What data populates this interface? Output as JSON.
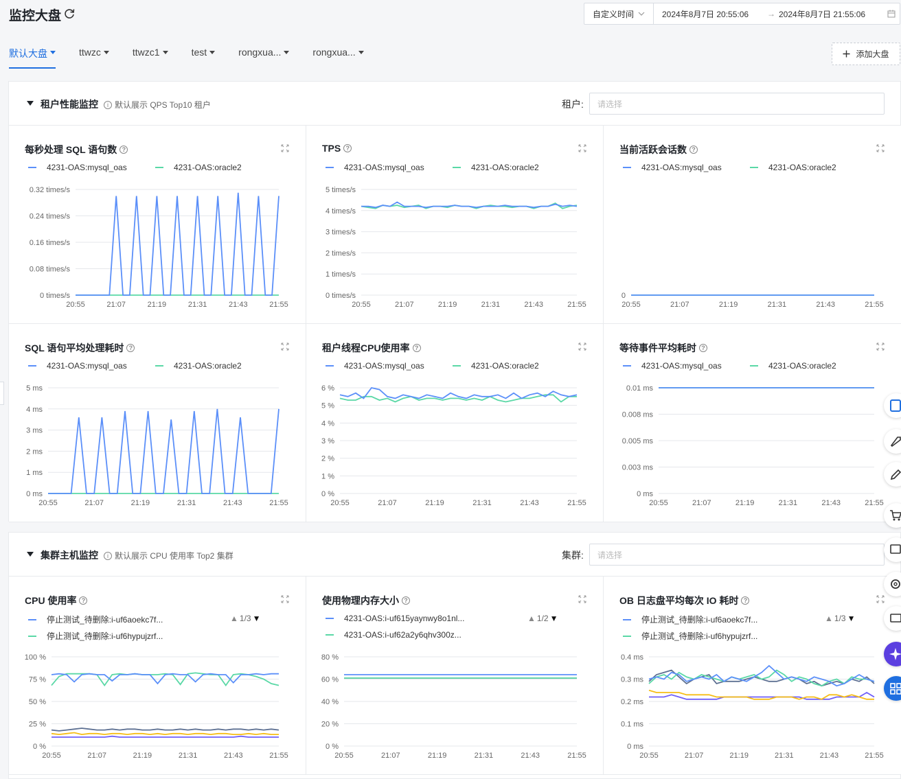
{
  "header": {
    "title": "监控大盘",
    "time_mode": "自定义时间",
    "time_start": "2024年8月7日 20:55:06",
    "time_arrow": "→",
    "time_end": "2024年8月7日 21:55:06"
  },
  "tabs": [
    {
      "label": "默认大盘",
      "active": true
    },
    {
      "label": "ttwzc",
      "active": false
    },
    {
      "label": "ttwzc1",
      "active": false
    },
    {
      "label": "test",
      "active": false
    },
    {
      "label": "rongxua...",
      "active": false
    },
    {
      "label": "rongxua...",
      "active": false
    }
  ],
  "add_board_label": "添加大盘",
  "colors": {
    "series1": "#5b8ff9",
    "series2": "#5ad8a6",
    "series3": "#5d7092",
    "series4": "#f6bd16",
    "series5": "#6f5ef9",
    "accent": "#1f6fe0"
  },
  "x_ticks": [
    "20:55",
    "21:07",
    "21:19",
    "21:31",
    "21:43",
    "21:55"
  ],
  "tenant_section": {
    "title": "租户性能监控",
    "hint": "默认展示 QPS Top10 租户",
    "filter_label": "租户:",
    "filter_placeholder": "请选择",
    "panels": [
      {
        "title": "每秒处理 SQL 语句数",
        "legend": [
          "4231-OAS:mysql_oas",
          "4231-OAS:oracle2"
        ],
        "y_ticks": [
          "0.32 times/s",
          "0.24 times/s",
          "0.16 times/s",
          "0.08 times/s",
          "0 times/s"
        ]
      },
      {
        "title": "TPS",
        "legend": [
          "4231-OAS:mysql_oas",
          "4231-OAS:oracle2"
        ],
        "y_ticks": [
          "5 times/s",
          "4 times/s",
          "3 times/s",
          "2 times/s",
          "1 times/s",
          "0 times/s"
        ]
      },
      {
        "title": "当前活跃会话数",
        "legend": [
          "4231-OAS:mysql_oas",
          "4231-OAS:oracle2"
        ],
        "y_ticks": [
          "0"
        ]
      },
      {
        "title": "SQL 语句平均处理耗时",
        "legend": [
          "4231-OAS:mysql_oas",
          "4231-OAS:oracle2"
        ],
        "y_ticks": [
          "5 ms",
          "4 ms",
          "3 ms",
          "2 ms",
          "1 ms",
          "0 ms"
        ]
      },
      {
        "title": "租户线程CPU使用率",
        "legend": [
          "4231-OAS:mysql_oas",
          "4231-OAS:oracle2"
        ],
        "y_ticks": [
          "6 %",
          "5 %",
          "4 %",
          "3 %",
          "2 %",
          "1 %",
          "0 %"
        ]
      },
      {
        "title": "等待事件平均耗时",
        "legend": [
          "4231-OAS:mysql_oas",
          "4231-OAS:oracle2"
        ],
        "y_ticks": [
          "0.01 ms",
          "0.008 ms",
          "0.005 ms",
          "0.003 ms",
          "0 ms"
        ]
      }
    ]
  },
  "cluster_section": {
    "title": "集群主机监控",
    "hint": "默认展示 CPU 使用率 Top2 集群",
    "filter_label": "集群:",
    "filter_placeholder": "请选择",
    "panels": [
      {
        "title": "CPU 使用率",
        "legend": [
          "停止测试_待删除:i-uf6aoekc7f...",
          "停止测试_待删除:i-uf6hypujzrf..."
        ],
        "pager": "1/3",
        "y_ticks": [
          "100 %",
          "75 %",
          "50 %",
          "25 %",
          "0 %"
        ]
      },
      {
        "title": "使用物理内存大小",
        "legend": [
          "4231-OAS:i-uf615yaynwy8o1nl...",
          "4231-OAS:i-uf62a2y6qhv300z..."
        ],
        "pager": "1/2",
        "y_ticks": [
          "80 %",
          "60 %",
          "40 %",
          "20 %",
          "0 %"
        ]
      },
      {
        "title": "OB 日志盘平均每次 IO 耗时",
        "legend": [
          "停止测试_待删除:i-uf6aoekc7f...",
          "停止测试_待删除:i-uf6hypujzrf..."
        ],
        "pager": "1/3",
        "y_ticks": [
          "0.4 ms",
          "0.3 ms",
          "0.2 ms",
          "0.1 ms",
          "0 ms"
        ]
      }
    ]
  },
  "chart_data": [
    {
      "type": "line",
      "title": "每秒处理 SQL 语句数",
      "ylim": [
        0,
        0.32
      ],
      "x_range": [
        "20:55",
        "21:55"
      ],
      "series": [
        {
          "name": "4231-OAS:mysql_oas",
          "values": [
            0,
            0,
            0,
            0,
            0,
            0,
            0.3,
            0,
            0,
            0.3,
            0,
            0,
            0.3,
            0,
            0,
            0.3,
            0,
            0,
            0.3,
            0,
            0,
            0.3,
            0,
            0,
            0.31,
            0,
            0,
            0.3,
            0,
            0,
            0.3
          ]
        },
        {
          "name": "4231-OAS:oracle2",
          "values": [
            0,
            0,
            0,
            0,
            0,
            0,
            0,
            0,
            0,
            0,
            0,
            0,
            0,
            0,
            0,
            0,
            0,
            0,
            0,
            0,
            0,
            0,
            0,
            0,
            0,
            0,
            0,
            0,
            0,
            0,
            0
          ]
        }
      ]
    },
    {
      "type": "line",
      "title": "TPS",
      "ylim": [
        0,
        5
      ],
      "x_range": [
        "20:55",
        "21:55"
      ],
      "series": [
        {
          "name": "4231-OAS:mysql_oas",
          "values": [
            4.2,
            4.2,
            4.15,
            4.25,
            4.2,
            4.4,
            4.2,
            4.2,
            4.2,
            4.15,
            4.2,
            4.2,
            4.2,
            4.25,
            4.2,
            4.2,
            4.15,
            4.2,
            4.2,
            4.2,
            4.25,
            4.2,
            4.2,
            4.2,
            4.15,
            4.2,
            4.2,
            4.3,
            4.2,
            4.25,
            4.2
          ]
        },
        {
          "name": "4231-OAS:oracle2",
          "values": [
            4.2,
            4.15,
            4.1,
            4.25,
            4.2,
            4.25,
            4.15,
            4.2,
            4.25,
            4.1,
            4.2,
            4.2,
            4.15,
            4.25,
            4.2,
            4.2,
            4.1,
            4.2,
            4.25,
            4.2,
            4.2,
            4.15,
            4.2,
            4.2,
            4.1,
            4.2,
            4.2,
            4.35,
            4.1,
            4.2,
            4.25
          ]
        }
      ]
    },
    {
      "type": "line",
      "title": "当前活跃会话数",
      "ylim": [
        0,
        1
      ],
      "x_range": [
        "20:55",
        "21:55"
      ],
      "series": [
        {
          "name": "4231-OAS:mysql_oas",
          "values": [
            0,
            0,
            0,
            0,
            0,
            0,
            0,
            0,
            0,
            0,
            0
          ]
        },
        {
          "name": "4231-OAS:oracle2",
          "values": [
            0,
            0,
            0,
            0,
            0,
            0,
            0,
            0,
            0,
            0,
            0
          ]
        }
      ]
    },
    {
      "type": "line",
      "title": "SQL 语句平均处理耗时",
      "ylim": [
        0,
        5
      ],
      "x_range": [
        "20:55",
        "21:55"
      ],
      "series": [
        {
          "name": "4231-OAS:mysql_oas",
          "values": [
            0,
            0,
            0,
            0,
            3.6,
            0,
            0,
            3.6,
            0,
            0,
            3.9,
            0,
            0,
            3.9,
            0,
            0,
            3.5,
            0,
            0,
            3.9,
            0,
            0,
            4.0,
            0,
            0,
            3.6,
            0,
            0,
            0,
            0,
            4.0
          ]
        },
        {
          "name": "4231-OAS:oracle2",
          "values": [
            0,
            0,
            0,
            0,
            0,
            0,
            0,
            0,
            0,
            0,
            0,
            0,
            0,
            0,
            0,
            0,
            0,
            0,
            0,
            0,
            0,
            0,
            0,
            0,
            0,
            0,
            0,
            0,
            0,
            0,
            0
          ]
        }
      ]
    },
    {
      "type": "line",
      "title": "租户线程CPU使用率",
      "ylim": [
        0,
        6
      ],
      "x_range": [
        "20:55",
        "21:55"
      ],
      "series": [
        {
          "name": "4231-OAS:mysql_oas",
          "values": [
            5.6,
            5.5,
            5.7,
            5.4,
            6.0,
            5.9,
            5.5,
            5.4,
            5.6,
            5.5,
            5.4,
            5.6,
            5.5,
            5.4,
            5.7,
            5.5,
            5.4,
            5.6,
            5.5,
            5.5,
            5.6,
            5.4,
            5.7,
            5.4,
            5.6,
            5.7,
            5.5,
            5.8,
            5.6,
            5.5,
            5.6
          ]
        },
        {
          "name": "4231-OAS:oracle2",
          "values": [
            5.4,
            5.3,
            5.3,
            5.5,
            5.5,
            5.3,
            5.4,
            5.2,
            5.4,
            5.5,
            5.3,
            5.4,
            5.4,
            5.3,
            5.4,
            5.4,
            5.3,
            5.4,
            5.3,
            5.5,
            5.3,
            5.2,
            5.3,
            5.4,
            5.4,
            5.5,
            5.6,
            5.6,
            5.2,
            5.5,
            5.5
          ]
        }
      ]
    },
    {
      "type": "line",
      "title": "等待事件平均耗时",
      "ylim": [
        0,
        0.01
      ],
      "x_range": [
        "20:55",
        "21:55"
      ],
      "series": [
        {
          "name": "4231-OAS:mysql_oas",
          "values": [
            0.01,
            0.01,
            0.01,
            0.01,
            0.01,
            0.01,
            0.01,
            0.01,
            0.01,
            0.01,
            0.01
          ]
        },
        {
          "name": "4231-OAS:oracle2",
          "values": [
            0.01,
            0.01,
            0.01,
            0.01,
            0.01,
            0.01,
            0.01,
            0.01,
            0.01,
            0.01,
            0.01
          ]
        }
      ]
    },
    {
      "type": "line",
      "title": "CPU 使用率",
      "ylim": [
        0,
        100
      ],
      "x_range": [
        "20:55",
        "21:55"
      ],
      "series": [
        {
          "name": "停止测试_待删除:i-uf6aoekc7f...",
          "values": [
            80,
            81,
            80,
            72,
            80,
            81,
            80,
            80,
            73,
            80,
            80,
            81,
            80,
            80,
            70,
            80,
            81,
            80,
            80,
            72,
            80,
            81,
            80,
            80,
            71,
            80,
            80,
            81,
            80,
            81,
            81
          ]
        },
        {
          "name": "停止测试_待删除:i-uf6hypujzrf...",
          "values": [
            68,
            78,
            81,
            81,
            81,
            81,
            80,
            68,
            80,
            81,
            80,
            81,
            80,
            80,
            80,
            81,
            80,
            69,
            81,
            82,
            81,
            80,
            80,
            68,
            80,
            81,
            80,
            78,
            75,
            70,
            68
          ]
        },
        {
          "values": [
            18,
            17,
            18,
            19,
            20,
            19,
            18,
            18,
            19,
            18,
            19,
            19,
            18,
            18,
            19,
            18,
            18,
            19,
            18,
            19,
            18,
            18,
            19,
            18,
            19,
            19,
            18,
            19,
            18,
            19,
            18
          ]
        },
        {
          "values": [
            14,
            13,
            14,
            15,
            13,
            14,
            14,
            13,
            14,
            14,
            13,
            14,
            14,
            13,
            14,
            13,
            14,
            14,
            13,
            14,
            14,
            13,
            14,
            14,
            13,
            13,
            14,
            13,
            14,
            13,
            13
          ]
        },
        {
          "values": [
            10,
            10,
            10,
            10,
            10,
            10,
            10,
            10,
            11,
            10,
            10,
            10,
            10,
            10,
            10,
            10,
            10,
            10,
            10,
            10,
            10,
            10,
            10,
            10,
            10,
            11,
            10,
            10,
            10,
            10,
            10
          ]
        }
      ]
    },
    {
      "type": "line",
      "title": "使用物理内存大小",
      "ylim": [
        0,
        80
      ],
      "x_range": [
        "20:55",
        "21:55"
      ],
      "series": [
        {
          "name": "4231-OAS:i-uf615yaynwy8o1nl...",
          "values": [
            64,
            64,
            64,
            64,
            64,
            64,
            64,
            64,
            64,
            64,
            64
          ]
        },
        {
          "name": "4231-OAS:i-uf62a2y6qhv300z...",
          "values": [
            61,
            61,
            61,
            61,
            61,
            61,
            61,
            61,
            61,
            61,
            61
          ]
        },
        {
          "values": [
            61,
            61,
            61,
            61,
            61,
            61,
            61,
            61,
            61,
            61,
            61
          ]
        }
      ]
    },
    {
      "type": "line",
      "title": "OB 日志盘平均每次 IO 耗时",
      "ylim": [
        0,
        0.4
      ],
      "x_range": [
        "20:55",
        "21:55"
      ],
      "series": [
        {
          "name": "停止测试_待删除:i-uf6aoekc7f...",
          "values": [
            0.3,
            0.31,
            0.3,
            0.33,
            0.32,
            0.29,
            0.3,
            0.31,
            0.3,
            0.32,
            0.29,
            0.31,
            0.3,
            0.29,
            0.31,
            0.33,
            0.36,
            0.33,
            0.3,
            0.31,
            0.3,
            0.29,
            0.31,
            0.3,
            0.29,
            0.27,
            0.28,
            0.3,
            0.32,
            0.3,
            0.29
          ]
        },
        {
          "name": "停止测试_待删除:i-uf6hypujzrf...",
          "values": [
            0.28,
            0.31,
            0.32,
            0.3,
            0.33,
            0.31,
            0.3,
            0.32,
            0.31,
            0.3,
            0.29,
            0.31,
            0.3,
            0.31,
            0.32,
            0.3,
            0.31,
            0.34,
            0.32,
            0.29,
            0.31,
            0.3,
            0.28,
            0.27,
            0.29,
            0.3,
            0.28,
            0.31,
            0.3,
            0.3,
            0.29
          ]
        },
        {
          "values": [
            0.29,
            0.32,
            0.33,
            0.34,
            0.31,
            0.28,
            0.3,
            0.31,
            0.32,
            0.28,
            0.29,
            0.29,
            0.29,
            0.3,
            0.31,
            0.3,
            0.29,
            0.29,
            0.3,
            0.31,
            0.3,
            0.28,
            0.29,
            0.27,
            0.28,
            0.29,
            0.28,
            0.3,
            0.29,
            0.31,
            0.28
          ]
        },
        {
          "values": [
            0.25,
            0.24,
            0.24,
            0.24,
            0.24,
            0.23,
            0.23,
            0.23,
            0.23,
            0.22,
            0.22,
            0.22,
            0.22,
            0.22,
            0.21,
            0.21,
            0.21,
            0.22,
            0.22,
            0.22,
            0.21,
            0.22,
            0.22,
            0.21,
            0.23,
            0.23,
            0.22,
            0.23,
            0.22,
            0.21,
            0.21
          ]
        },
        {
          "values": [
            0.22,
            0.22,
            0.22,
            0.23,
            0.22,
            0.21,
            0.21,
            0.21,
            0.21,
            0.21,
            0.22,
            0.22,
            0.22,
            0.22,
            0.22,
            0.22,
            0.22,
            0.22,
            0.22,
            0.22,
            0.22,
            0.21,
            0.21,
            0.21,
            0.21,
            0.22,
            0.22,
            0.22,
            0.22,
            0.24,
            0.22
          ]
        }
      ]
    }
  ]
}
